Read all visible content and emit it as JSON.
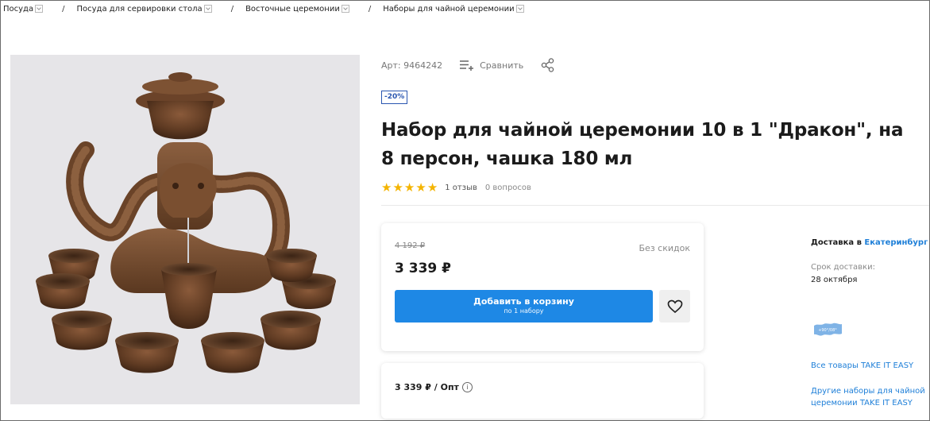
{
  "breadcrumb": [
    {
      "label": "Посуда"
    },
    {
      "label": "Посуда для сервировки стола"
    },
    {
      "label": "Восточные церемонии"
    },
    {
      "label": "Наборы для чайной церемонии"
    }
  ],
  "breadcrumb_separator": "/",
  "product": {
    "article": "Арт: 9464242",
    "compare_label": "Сравнить",
    "discount_badge": "-20%",
    "title": "Набор для чайной церемонии 10 в 1 \"Дракон\", на 8 персон, чашка 180 мл",
    "rating": 5,
    "reviews": "1 отзыв",
    "questions": "0 вопросов"
  },
  "price_card": {
    "old_price": "4 192 ₽",
    "no_discount_label": "Без скидок",
    "current_price": "3 339 ₽",
    "add_to_cart_label": "Добавить в корзину",
    "add_to_cart_sub": "по 1 набору"
  },
  "wholesale": {
    "price_text": "3 339 ₽ / Опт",
    "info_symbol": "i"
  },
  "delivery": {
    "title_prefix": "Доставка в",
    "city": "Екатеринбург",
    "term_label": "Срок доставки:",
    "date": "28 октября"
  },
  "sidebar_links": {
    "brand_logo_text": "+90°/08°",
    "brand_all": "Все товары TAKE IT EASY",
    "other_sets": "Другие наборы для чайной церемонии TAKE IT EASY"
  },
  "colors": {
    "accent_blue": "#1e88e5",
    "link_blue": "#1e7fd8",
    "star_yellow": "#f4b400",
    "badge_blue": "#2a56b0"
  },
  "icons": {
    "compare": "compare-list-icon",
    "share": "share-icon",
    "favorite": "heart-icon",
    "info": "info-icon",
    "dropdown": "chevron-down-icon"
  }
}
